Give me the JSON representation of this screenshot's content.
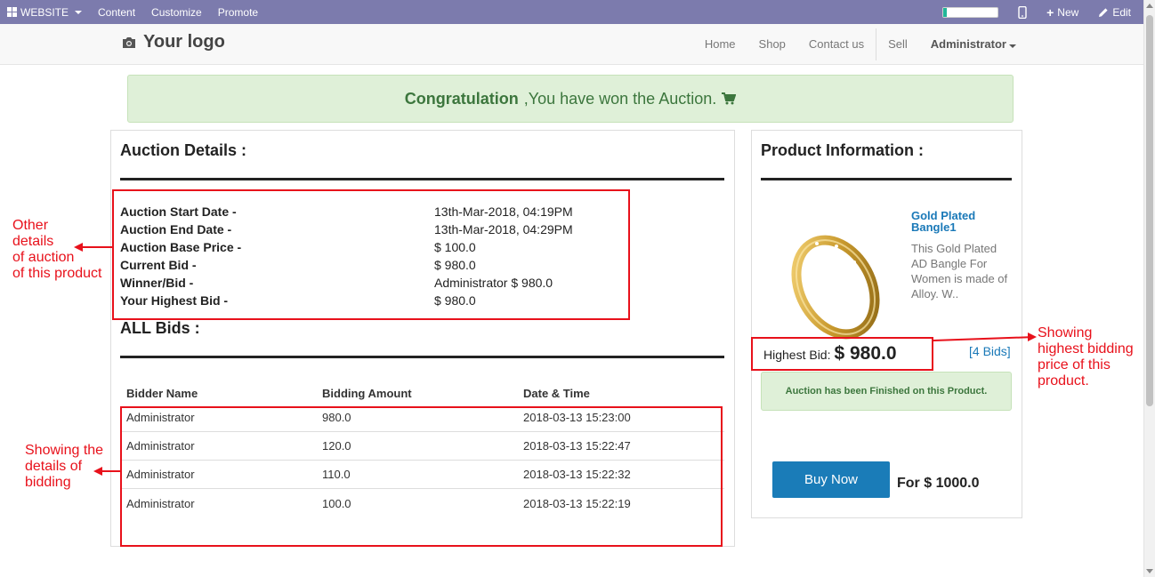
{
  "adminbar": {
    "website_label": "WEBSITE",
    "menu": [
      "Content",
      "Customize",
      "Promote"
    ],
    "progress": 0.07,
    "new_label": "New",
    "edit_label": "Edit"
  },
  "navbar": {
    "logo_text": "Your logo",
    "links": [
      "Home",
      "Shop",
      "Contact us",
      "Sell"
    ],
    "user": "Administrator"
  },
  "alert": {
    "strong": "Congratulation",
    "text": " ,You have won the Auction."
  },
  "auction": {
    "title": "Auction Details :",
    "details": [
      {
        "label": "Auction Start Date -",
        "value": "13th-Mar-2018, 04:19PM"
      },
      {
        "label": "Auction End Date -",
        "value": "13th-Mar-2018, 04:29PM"
      },
      {
        "label": "Auction Base Price -",
        "value": "$ 100.0"
      },
      {
        "label": "Current Bid -",
        "value": "$ 980.0"
      },
      {
        "label": "Winner/Bid -",
        "value": "Administrator $ 980.0"
      },
      {
        "label": "Your Highest Bid -",
        "value": "$ 980.0"
      }
    ],
    "all_bids_title": "ALL Bids :",
    "columns": [
      "Bidder Name",
      "Bidding Amount",
      "Date & Time"
    ],
    "bids": [
      {
        "bidder": "Administrator",
        "amount": "980.0",
        "datetime": "2018-03-13 15:23:00"
      },
      {
        "bidder": "Administrator",
        "amount": "120.0",
        "datetime": "2018-03-13 15:22:47"
      },
      {
        "bidder": "Administrator",
        "amount": "110.0",
        "datetime": "2018-03-13 15:22:32"
      },
      {
        "bidder": "Administrator",
        "amount": "100.0",
        "datetime": "2018-03-13 15:22:19"
      }
    ]
  },
  "product": {
    "title": "Product Information :",
    "name": "Gold Plated Bangle1",
    "description": "This Gold Plated AD Bangle For Women is made of Alloy. W..",
    "highest_bid_label": "Highest Bid:",
    "highest_bid_value": "$ 980.0",
    "bids_link": "[4 Bids]",
    "finished_text": "Auction has been Finished on this Product.",
    "buy_now": "Buy Now",
    "buy_price": "For $ 1000.0"
  },
  "annotations": {
    "details_note": [
      "Other",
      "details",
      "of auction",
      "of this product"
    ],
    "bidding_note": [
      "Showing the",
      "details of",
      "bidding"
    ],
    "price_note": [
      "Showing",
      "highest bidding",
      "price of this",
      "product."
    ]
  },
  "colors": {
    "adminbar": "#7c7bad",
    "annotation_red": "#e8111b",
    "success_bg": "#dff0d8",
    "success_text": "#3c763d",
    "primary": "#1a7cb8"
  }
}
